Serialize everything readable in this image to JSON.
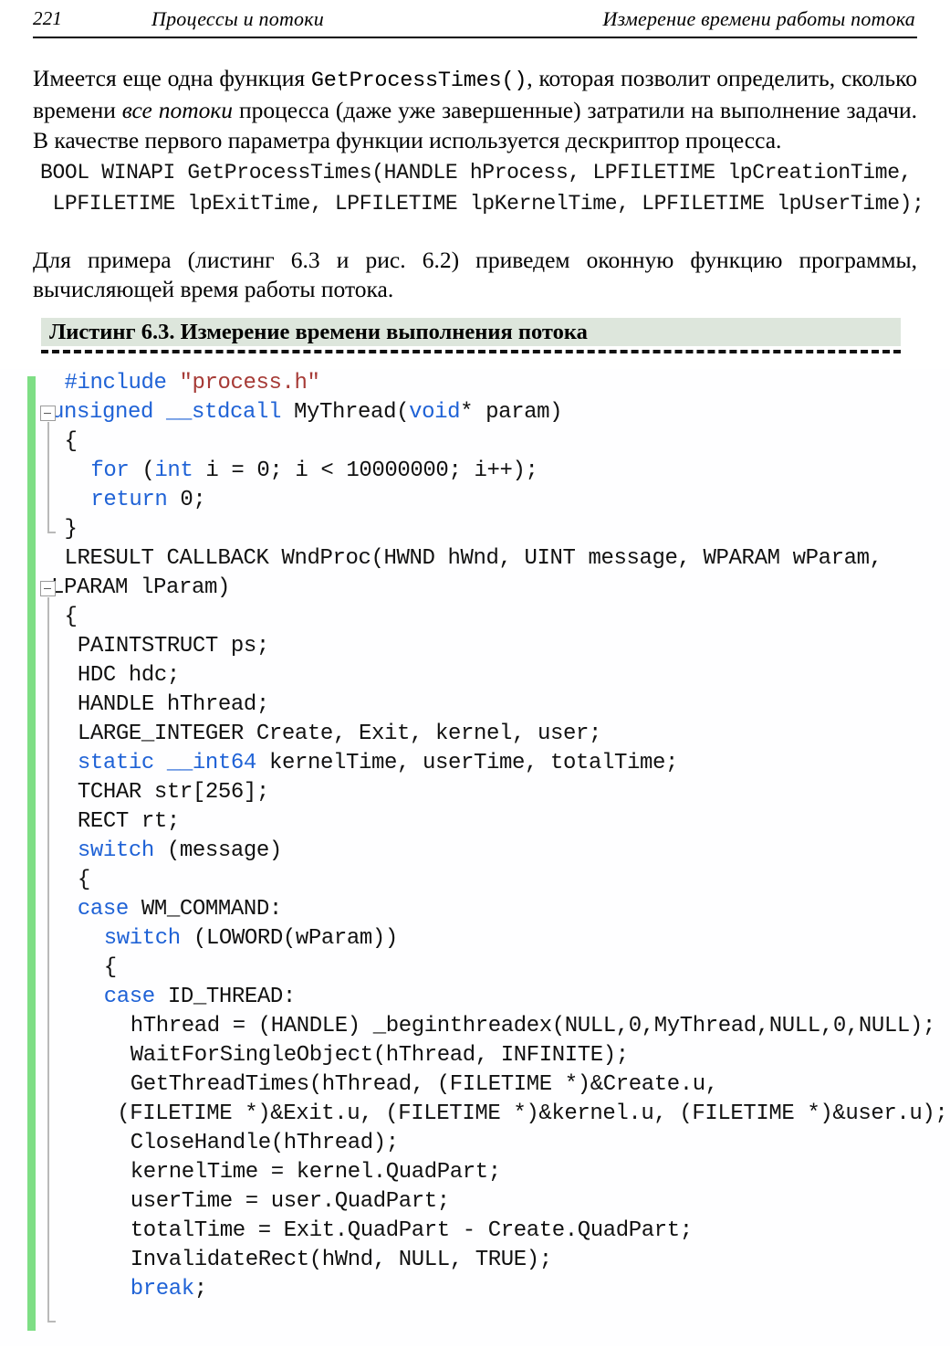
{
  "header": {
    "folio": "221",
    "left_title": "Процессы и потоки",
    "right_title": "Измерение времени работы потока"
  },
  "paragraphs": {
    "intro_part1": "Имеется еще одна функция ",
    "intro_mono": "GetProcessTimes()",
    "intro_part2": ", которая позволит определить, сколько времени ",
    "intro_italic": "все потоки",
    "intro_part3": " процесса (даже уже завершенные) затратили на выполнение задачи. В качестве первого параметра функции используется дескриптор процесса.",
    "follow": "Для примера (листинг 6.3 и рис. 6.2) приведем оконную функцию программы, вычисляющей время работы потока."
  },
  "prototype": {
    "line1": "BOOL WINAPI GetProcessTimes(HANDLE hProcess, LPFILETIME lpCreationTime,",
    "line2": " LPFILETIME lpExitTime, LPFILETIME lpKernelTime, LPFILETIME lpUserTime);"
  },
  "listing": {
    "caption": "Листинг 6.3. Измерение времени выполнения потока",
    "header_bg": "#dde6dc",
    "change_bar_color": "#7ede85",
    "keyword_color": "#1f62d6",
    "string_color": "#a63a36",
    "lines": [
      {
        "indent": 1,
        "fold": false,
        "tokens": [
          {
            "t": "#include ",
            "c": "pre"
          },
          {
            "t": "\"process.h\"",
            "c": "str"
          }
        ]
      },
      {
        "indent": 0,
        "fold": true,
        "tokens": [
          {
            "t": "unsigned __stdcall ",
            "c": "kw"
          },
          {
            "t": "MyThread(",
            "c": "num"
          },
          {
            "t": "void",
            "c": "kw"
          },
          {
            "t": "* param)",
            "c": "num"
          }
        ]
      },
      {
        "indent": 1,
        "fold": false,
        "tokens": [
          {
            "t": "{",
            "c": "num"
          }
        ]
      },
      {
        "indent": 3,
        "fold": false,
        "tokens": [
          {
            "t": "for ",
            "c": "kw"
          },
          {
            "t": "(",
            "c": "num"
          },
          {
            "t": "int",
            "c": "kw"
          },
          {
            "t": " i = 0; i < 10000000; i++);",
            "c": "num"
          }
        ]
      },
      {
        "indent": 3,
        "fold": false,
        "tokens": [
          {
            "t": "return",
            "c": "kw"
          },
          {
            "t": " 0;",
            "c": "num"
          }
        ]
      },
      {
        "indent": 1,
        "fold": false,
        "tokens": [
          {
            "t": "}",
            "c": "num"
          }
        ]
      },
      {
        "indent": 1,
        "fold": false,
        "tokens": [
          {
            "t": "LRESULT CALLBACK WndProc(HWND hWnd, UINT message, WPARAM wParam,",
            "c": "num"
          }
        ]
      },
      {
        "indent": 0,
        "fold": true,
        "tokens": [
          {
            "t": "LPARAM lParam)",
            "c": "num"
          }
        ]
      },
      {
        "indent": 1,
        "fold": false,
        "tokens": [
          {
            "t": "{",
            "c": "num"
          }
        ]
      },
      {
        "indent": 2,
        "fold": false,
        "tokens": [
          {
            "t": "PAINTSTRUCT ps;",
            "c": "num"
          }
        ]
      },
      {
        "indent": 2,
        "fold": false,
        "tokens": [
          {
            "t": "HDC hdc;",
            "c": "num"
          }
        ]
      },
      {
        "indent": 2,
        "fold": false,
        "tokens": [
          {
            "t": "HANDLE hThread;",
            "c": "num"
          }
        ]
      },
      {
        "indent": 2,
        "fold": false,
        "tokens": [
          {
            "t": "LARGE_INTEGER Create, Exit, kernel, user;",
            "c": "num"
          }
        ]
      },
      {
        "indent": 2,
        "fold": false,
        "tokens": [
          {
            "t": "static __int64",
            "c": "kw"
          },
          {
            "t": " kernelTime, userTime, totalTime;",
            "c": "num"
          }
        ]
      },
      {
        "indent": 2,
        "fold": false,
        "tokens": [
          {
            "t": "TCHAR str[256];",
            "c": "num"
          }
        ]
      },
      {
        "indent": 2,
        "fold": false,
        "tokens": [
          {
            "t": "RECT rt;",
            "c": "num"
          }
        ]
      },
      {
        "indent": 2,
        "fold": false,
        "tokens": [
          {
            "t": "switch",
            "c": "kw"
          },
          {
            "t": " (message)",
            "c": "num"
          }
        ]
      },
      {
        "indent": 2,
        "fold": false,
        "tokens": [
          {
            "t": "{",
            "c": "num"
          }
        ]
      },
      {
        "indent": 2,
        "fold": false,
        "tokens": [
          {
            "t": "case",
            "c": "kw"
          },
          {
            "t": " WM_COMMAND:",
            "c": "num"
          }
        ]
      },
      {
        "indent": 4,
        "fold": false,
        "tokens": [
          {
            "t": "switch",
            "c": "kw"
          },
          {
            "t": " (LOWORD(wParam))",
            "c": "num"
          }
        ]
      },
      {
        "indent": 4,
        "fold": false,
        "tokens": [
          {
            "t": "{",
            "c": "num"
          }
        ]
      },
      {
        "indent": 4,
        "fold": false,
        "tokens": [
          {
            "t": "case",
            "c": "kw"
          },
          {
            "t": " ID_THREAD:",
            "c": "num"
          }
        ]
      },
      {
        "indent": 6,
        "fold": false,
        "tokens": [
          {
            "t": "hThread = (HANDLE) _beginthreadex(NULL,0,MyThread,NULL,0,NULL);",
            "c": "num"
          }
        ]
      },
      {
        "indent": 6,
        "fold": false,
        "tokens": [
          {
            "t": "WaitForSingleObject(hThread, INFINITE);",
            "c": "num"
          }
        ]
      },
      {
        "indent": 6,
        "fold": false,
        "tokens": [
          {
            "t": "GetThreadTimes(hThread, (FILETIME *)&Create.u,",
            "c": "num"
          }
        ]
      },
      {
        "indent": 5,
        "fold": false,
        "tokens": [
          {
            "t": "(FILETIME *)&Exit.u, (FILETIME *)&kernel.u, (FILETIME *)&user.u);",
            "c": "num"
          }
        ]
      },
      {
        "indent": 6,
        "fold": false,
        "tokens": [
          {
            "t": "CloseHandle(hThread);",
            "c": "num"
          }
        ]
      },
      {
        "indent": 6,
        "fold": false,
        "tokens": [
          {
            "t": "kernelTime = kernel.QuadPart;",
            "c": "num"
          }
        ]
      },
      {
        "indent": 6,
        "fold": false,
        "tokens": [
          {
            "t": "userTime = user.QuadPart;",
            "c": "num"
          }
        ]
      },
      {
        "indent": 6,
        "fold": false,
        "tokens": [
          {
            "t": "totalTime = Exit.QuadPart - Create.QuadPart;",
            "c": "num"
          }
        ]
      },
      {
        "indent": 6,
        "fold": false,
        "tokens": [
          {
            "t": "InvalidateRect(hWnd, NULL, TRUE);",
            "c": "num"
          }
        ]
      },
      {
        "indent": 6,
        "fold": false,
        "tokens": [
          {
            "t": "break",
            "c": "kw"
          },
          {
            "t": ";",
            "c": "num"
          }
        ]
      }
    ]
  }
}
